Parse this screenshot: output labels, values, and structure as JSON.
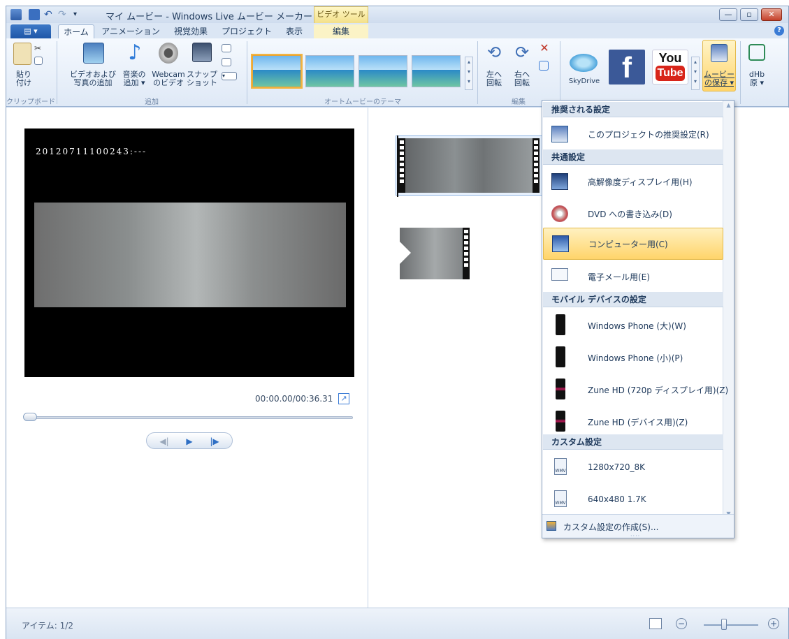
{
  "window": {
    "title": "マイ ムービー - Windows Live ムービー メーカー",
    "context_tab_group": "ビデオ ツール"
  },
  "tabs": {
    "app_menu": "▤ ▾",
    "items": [
      "ホーム",
      "アニメーション",
      "視覚効果",
      "プロジェクト",
      "表示",
      "編集"
    ]
  },
  "ribbon": {
    "clipboard": {
      "paste": "貼り\n付け",
      "group": "クリップボード"
    },
    "add": {
      "add_videos_photos": "ビデオおよび\n写真の追加",
      "add_music": "音楽の\n追加 ▾",
      "webcam_video": "Webcam\nのビデオ",
      "snapshot": "スナップ\nショット",
      "group": "追加"
    },
    "themes": {
      "group": "オートムービーのテーマ"
    },
    "edit": {
      "rotate_left": "左へ\n回転",
      "rotate_right": "右へ\n回転",
      "group": "編集"
    },
    "share": {
      "skydrive": "SkyDrive",
      "youtube_top": "You",
      "youtube_bottom": "Tube"
    },
    "save_movie": "ムービー\nの保存 ▾",
    "dhb": "dHb\n原 ▾"
  },
  "preview": {
    "timestamp_overlay": "20120711100243:---",
    "time_readout": "00:00.00/00:36.31",
    "seek_position": 0.0
  },
  "save_menu": {
    "sections": [
      {
        "header": "推奨される設定",
        "items": [
          {
            "label": "このプロジェクトの推奨設定(R)",
            "icon": "recommended-settings-icon"
          }
        ]
      },
      {
        "header": "共通設定",
        "items": [
          {
            "label": "高解像度ディスプレイ用(H)",
            "icon": "hd-display-icon"
          },
          {
            "label": "DVD への書き込み(D)",
            "icon": "dvd-icon"
          },
          {
            "label": "コンピューター用(C)",
            "icon": "computer-icon"
          },
          {
            "label": "電子メール用(E)",
            "icon": "email-icon"
          }
        ]
      },
      {
        "header": "モバイル デバイスの設定",
        "items": [
          {
            "label": "Windows Phone (大)(W)",
            "icon": "windows-phone-icon"
          },
          {
            "label": "Windows Phone (小)(P)",
            "icon": "windows-phone-icon"
          },
          {
            "label": "Zune HD (720p ディスプレイ用)(Z)",
            "icon": "zune-icon"
          },
          {
            "label": "Zune HD (デバイス用)(Z)",
            "icon": "zune-icon"
          }
        ]
      },
      {
        "header": "カスタム設定",
        "items": [
          {
            "label": "1280x720_8K",
            "icon": "wmv-file-icon"
          },
          {
            "label": "640x480 1.7K",
            "icon": "wmv-file-icon"
          }
        ]
      }
    ],
    "footer": "カスタム設定の作成(S)..."
  },
  "status": {
    "item_count": "アイテム: 1/2",
    "zoom_level": 0.35
  },
  "colors": {
    "ribbon_bg": "#dfe9f6",
    "highlight": "#ffd46a",
    "accent_blue": "#3a7bd5"
  }
}
